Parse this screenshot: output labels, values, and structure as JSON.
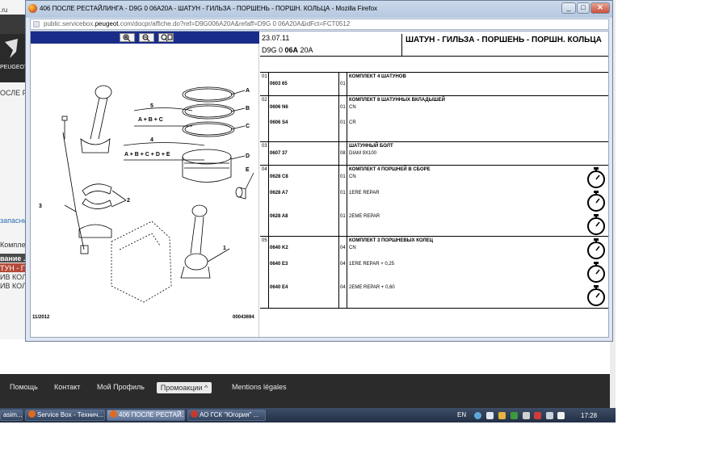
{
  "window": {
    "title": "406 ПОСЛЕ РЕСТАЙЛИНГА - D9G 0 06A20A - ШАТУН - ГИЛЬЗА - ПОРШЕНЬ - ПОРШН. КОЛЬЦА - Mozilla Firefox",
    "url_host": "public.servicebox.",
    "url_domain": "peugeot",
    "url_rest": ".com/docpr/affiche.do?ref=D9G006A20A&refaff=D9G 0 06A20A&idFct=FCT0512"
  },
  "background_page": {
    "left_texts": [
      ".ru",
      "ОСЛЕ РЕ",
      "запасны",
      "Комплект",
      "вание .",
      "ТУН - ГИ",
      "ИВ КОЛЕ",
      "ИВ КОЛЕ"
    ],
    "brand_text": "PEUGEOT",
    "footer_links": [
      "Помощь",
      "Контакт",
      "Мой Профиль",
      "Mentions légales"
    ],
    "promo_label": "Промоакции ^"
  },
  "taskbar": {
    "items": [
      {
        "label": "asim..."
      },
      {
        "label": "Service Box - Технич..."
      },
      {
        "label": "406 ПОСЛЕ РЕСТАЙ..."
      },
      {
        "label": "АО ГСК \"Югория\" ..."
      }
    ],
    "lang": "EN",
    "time": "17:28"
  },
  "diagram": {
    "date": "11/2012",
    "ref": "00043694",
    "labels": {
      "A": "A",
      "B": "B",
      "C": "C",
      "D": "D",
      "E": "E",
      "n1": "1",
      "n2": "2",
      "n3": "3",
      "n4": "4",
      "n5": "5",
      "formula5": "A + B + C",
      "formula4": "A + B + C + D + E"
    }
  },
  "header": {
    "date": "23.07.11",
    "code_prefix": "D9G 0 ",
    "code_bold": "06A",
    "code_suffix": " 20A",
    "title": "ШАТУН - ГИЛЬЗА - ПОРШЕНЬ - ПОРШН. КОЛЬЦА"
  },
  "groups": [
    {
      "num": "01",
      "title": "КОМПЛЕКТ 4 ШАТУНОВ",
      "parts": [
        {
          "ref": "0603 65",
          "qty": "01",
          "desc": ""
        }
      ]
    },
    {
      "num": "02",
      "title": "КОМПЛЕКТ 8 ШАТУННЫХ ВКЛАДЫШЕЙ",
      "parts": [
        {
          "ref": "0606 N6",
          "qty": "01",
          "desc": "CN"
        },
        {
          "ref": "0606 S4",
          "qty": "01",
          "desc": "CR"
        }
      ]
    },
    {
      "num": "03",
      "title": "ШАТУННЫЙ БОЛТ",
      "parts": [
        {
          "ref": "0607 37",
          "qty": "08",
          "desc": "DIAM 9X100"
        }
      ]
    },
    {
      "num": "04",
      "title": "КОМПЛЕКТ 4 ПОРШНЕЙ В СБОРЕ",
      "parts": [
        {
          "ref": "0628 C8",
          "qty": "01",
          "desc": "CN"
        },
        {
          "ref": "0628 A7",
          "qty": "01",
          "desc": "1ERE REPAR"
        },
        {
          "ref": "0628 A8",
          "qty": "01",
          "desc": "2EME REPAR"
        }
      ]
    },
    {
      "num": "05",
      "title": "КОМПЛЕКТ 3 ПОРШНЕВЫХ КОЛЕЦ",
      "parts": [
        {
          "ref": "0640 K2",
          "qty": "04",
          "desc": "CN"
        },
        {
          "ref": "0640 E3",
          "qty": "04",
          "desc": "1ERE REPAR + 0,25"
        },
        {
          "ref": "0640 E4",
          "qty": "04",
          "desc": "2EME REPAR + 0,60"
        }
      ]
    }
  ]
}
